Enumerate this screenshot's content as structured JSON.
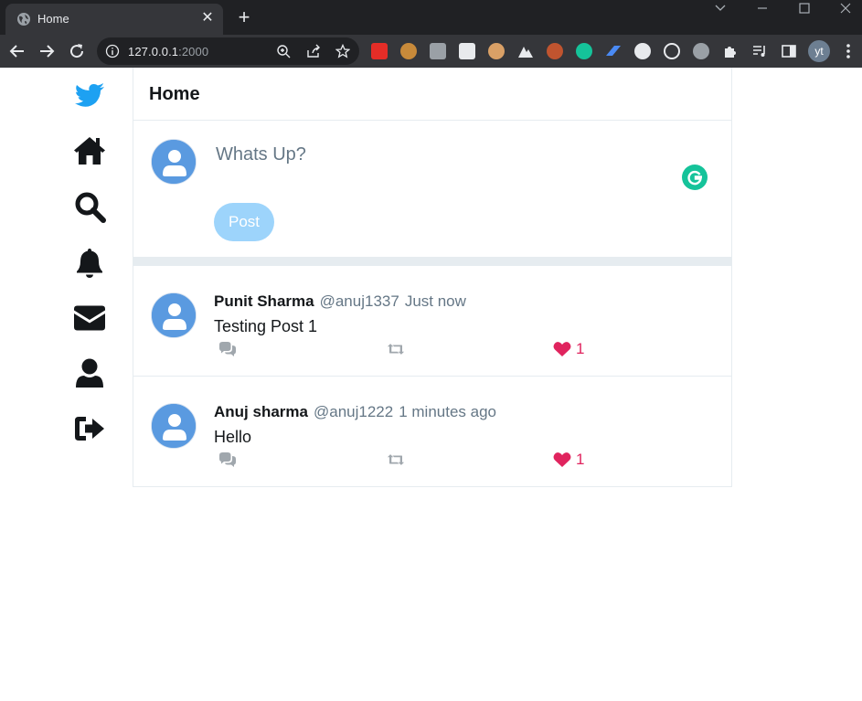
{
  "browser": {
    "tab_title": "Home",
    "tab_close": "✕",
    "new_tab": "+",
    "url_host": "127.0.0.1",
    "url_port": ":2000",
    "profile_initials": "yt"
  },
  "page": {
    "header_title": "Home",
    "composer": {
      "placeholder": "Whats Up?",
      "post_label": "Post"
    },
    "posts": [
      {
        "name": "Punit Sharma",
        "handle": "@anuj1337",
        "time": "Just now",
        "content": "Testing Post 1",
        "likes": "1"
      },
      {
        "name": "Anuj sharma",
        "handle": "@anuj1222",
        "time": "1 minutes ago",
        "content": "Hello",
        "likes": "1"
      }
    ]
  },
  "colors": {
    "brand_blue": "#1da1f2",
    "post_button": "#9dd4fb",
    "like_red": "#e0245e",
    "avatar_blue": "#5a9ae0",
    "grammarly_green": "#15c39a"
  },
  "icons": {
    "sidebar": [
      "bird-logo-icon",
      "home-icon",
      "search-icon",
      "bell-icon",
      "envelope-icon",
      "user-icon",
      "logout-icon"
    ],
    "post_actions": [
      "reply-icon",
      "retweet-icon",
      "heart-icon"
    ]
  }
}
